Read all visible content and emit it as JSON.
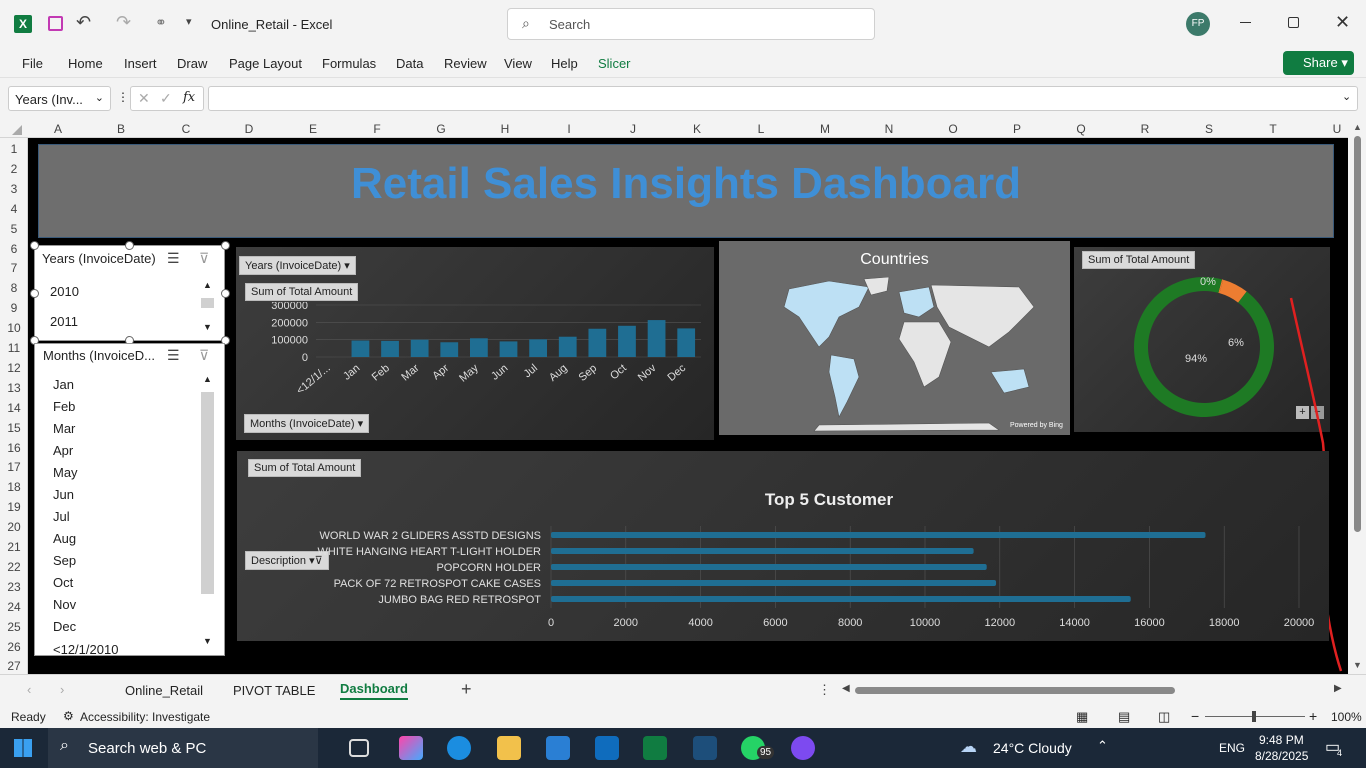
{
  "window": {
    "filename": "Online_Retail",
    "app": "Excel",
    "search_placeholder": "Search",
    "user_initials": "FP"
  },
  "ribbon": {
    "tabs": [
      "File",
      "Home",
      "Insert",
      "Draw",
      "Page Layout",
      "Formulas",
      "Data",
      "Review",
      "View",
      "Help",
      "Slicer"
    ],
    "share_label": "Share"
  },
  "formula": {
    "name_box": "Years (Inv...",
    "fx": "fx",
    "value": ""
  },
  "columns": [
    "A",
    "B",
    "C",
    "D",
    "E",
    "F",
    "G",
    "H",
    "I",
    "J",
    "K",
    "L",
    "M",
    "N",
    "O",
    "P",
    "Q",
    "R",
    "S",
    "T",
    "U"
  ],
  "rows": [
    "1",
    "2",
    "3",
    "4",
    "5",
    "6",
    "7",
    "8",
    "9",
    "10",
    "11",
    "12",
    "13",
    "14",
    "15",
    "16",
    "17",
    "18",
    "19",
    "20",
    "21",
    "22",
    "23",
    "24",
    "25",
    "26",
    "27"
  ],
  "dashboard": {
    "title": "Retail Sales Insights Dashboard",
    "years_slicer": {
      "title": "Years (InvoiceDate)",
      "items": [
        "2010",
        "2011"
      ]
    },
    "months_slicer": {
      "title": "Months (InvoiceD...",
      "items": [
        "Jan",
        "Feb",
        "Mar",
        "Apr",
        "May",
        "Jun",
        "Jul",
        "Aug",
        "Sep",
        "Oct",
        "Nov",
        "Dec",
        "<12/1/2010"
      ]
    },
    "monthly_chart": {
      "filter_label": "Years (InvoiceDate)",
      "value_label": "Sum of Total Amount",
      "axis_field": "Months (InvoiceDate)"
    },
    "map": {
      "title": "Countries",
      "credit": "Powered by Bing"
    },
    "donut": {
      "value_label": "Sum of Total Amount",
      "labels": [
        "0%",
        "6%",
        "94%"
      ]
    },
    "top5": {
      "value_label": "Sum of Total Amount",
      "title": "Top 5 Customer",
      "axis_field": "Description"
    }
  },
  "chart_data": [
    {
      "type": "bar",
      "categories": [
        "<12/1/...",
        "Jan",
        "Feb",
        "Mar",
        "Apr",
        "May",
        "Jun",
        "Jul",
        "Aug",
        "Sep",
        "Oct",
        "Nov",
        "Dec"
      ],
      "values": [
        0,
        95000,
        93000,
        100000,
        85000,
        108000,
        90000,
        102000,
        117000,
        163000,
        180000,
        213000,
        165000
      ],
      "ylim": [
        0,
        300000
      ],
      "yticks": [
        "300000",
        "200000",
        "100000",
        "0"
      ],
      "color": "#1f6e93"
    },
    {
      "type": "pie",
      "labels": [
        "0%",
        "6%",
        "94%"
      ],
      "values": [
        0.3,
        6,
        93.7
      ],
      "colors": [
        "#ed7d31",
        "#ed7d31",
        "#1e7a24"
      ]
    },
    {
      "type": "bar",
      "orientation": "horizontal",
      "title": "Top 5 Customer",
      "categories": [
        "WORLD WAR 2 GLIDERS ASSTD DESIGNS",
        "WHITE HANGING HEART T-LIGHT HOLDER",
        "POPCORN HOLDER",
        "PACK OF 72 RETROSPOT CAKE CASES",
        "JUMBO BAG RED RETROSPOT"
      ],
      "values": [
        17500,
        11300,
        11650,
        11900,
        15500
      ],
      "xlim": [
        0,
        20000
      ],
      "xticks": [
        "0",
        "2000",
        "4000",
        "6000",
        "8000",
        "10000",
        "12000",
        "14000",
        "16000",
        "18000",
        "20000"
      ],
      "color": "#1f6e93"
    }
  ],
  "sheets": {
    "tabs": [
      "Online_Retail",
      "PIVOT TABLE",
      "Dashboard"
    ],
    "active": "Dashboard"
  },
  "status": {
    "ready": "Ready",
    "accessibility": "Accessibility: Investigate",
    "zoom": "100%"
  },
  "taskbar": {
    "search": "Search web & PC",
    "weather": "24°C  Cloudy",
    "lang": "ENG",
    "time": "9:48 PM",
    "date": "8/28/2025",
    "notif": "4",
    "whatsapp_badge": "95"
  }
}
